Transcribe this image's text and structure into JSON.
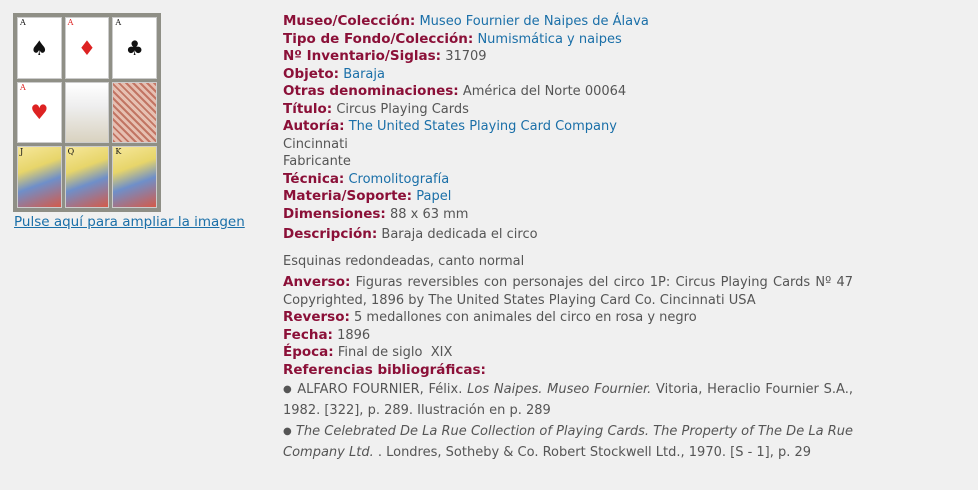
{
  "thumbnail": {
    "cards": [
      {
        "kind": "ace",
        "suit": "♠",
        "index": "A",
        "color": "#111"
      },
      {
        "kind": "ace",
        "suit": "♦",
        "index": "A",
        "color": "#d22"
      },
      {
        "kind": "ace",
        "suit": "♣",
        "index": "A",
        "color": "#111"
      },
      {
        "kind": "ace",
        "suit": "♥",
        "index": "A",
        "color": "#d22"
      },
      {
        "kind": "circus",
        "suit": "",
        "index": "",
        "color": "#111"
      },
      {
        "kind": "back",
        "suit": "",
        "index": "",
        "color": "#111"
      },
      {
        "kind": "face",
        "suit": "",
        "index": "J",
        "color": "#111"
      },
      {
        "kind": "face",
        "suit": "",
        "index": "Q",
        "color": "#111"
      },
      {
        "kind": "face",
        "suit": "",
        "index": "K",
        "color": "#111"
      }
    ],
    "enlarge_link": "Pulse aquí para ampliar la imagen"
  },
  "record": {
    "museo": {
      "label": "Museo/Colección:",
      "value": "Museo Fournier de Naipes de Álava"
    },
    "tipo": {
      "label": "Tipo de Fondo/Colección:",
      "value": "Numismática y naipes"
    },
    "inventario": {
      "label": "Nº Inventario/Siglas:",
      "value": "31709"
    },
    "objeto": {
      "label": "Objeto:",
      "value": "Baraja"
    },
    "otras": {
      "label": "Otras denominaciones:",
      "value": "América del Norte 00064"
    },
    "titulo": {
      "label": "Título:",
      "value": "Circus Playing Cards"
    },
    "autoria": {
      "label": "Autoría:",
      "value": "The United States Playing Card Company"
    },
    "lugar": "Cincinnati",
    "rol": "Fabricante",
    "tecnica": {
      "label": "Técnica:",
      "value": "Cromolitografía"
    },
    "materia": {
      "label": "Materia/Soporte:",
      "value": "Papel"
    },
    "dimensiones": {
      "label": "Dimensiones:",
      "value": "88 x 63 mm"
    },
    "descripcion": {
      "label": "Descripción:",
      "value": "Baraja dedicada el circo",
      "extra": "Esquinas redondeadas, canto normal"
    },
    "anverso": {
      "label": "Anverso:",
      "value": "Figuras reversibles con personajes del circo 1P: Circus Playing Cards Nº 47 Copyrighted, 1896 by The United States Playing Card Co. Cincinnati USA"
    },
    "reverso": {
      "label": "Reverso:",
      "value": "5 medallones con animales del circo en rosa y negro"
    },
    "fecha": {
      "label": "Fecha:",
      "value": "1896"
    },
    "epoca": {
      "label": "Época:",
      "value": "Final de siglo  XIX"
    },
    "referencias": {
      "label": "Referencias bibliográficas:",
      "items": [
        {
          "pre": "ALFARO FOURNIER, Félix. ",
          "italic": "Los Naipes. Museo Fournier.",
          "post": " Vitoria, Heraclio Fournier S.A., 1982. [322], p. 289. Ilustración en p. 289"
        },
        {
          "pre": "",
          "italic": "The Celebrated De La Rue Collection of Playing Cards. The Property of The De La Rue Company Ltd.",
          "post": " . Londres, Sotheby & Co. Robert Stockwell Ltd., 1970. [S - 1], p. 29"
        }
      ]
    }
  },
  "colors": {
    "label": "#8b1038",
    "link": "#1a6fa8",
    "text": "#555555",
    "background": "#f0f0f0"
  }
}
